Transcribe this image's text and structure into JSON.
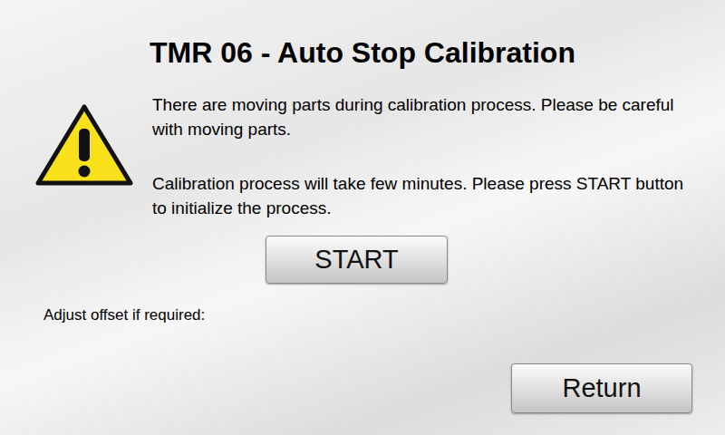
{
  "window": {
    "title": "TMR 06 - Auto Stop Calibration"
  },
  "warning": {
    "paragraphs": [
      "There are moving parts during calibration process. Please be careful with moving parts.",
      "Calibration process will take few minutes. Please press START button to initialize the process."
    ]
  },
  "start_button": {
    "label": "START"
  },
  "offset": {
    "label": "Adjust offset if required:"
  },
  "return_button": {
    "label": "Return"
  }
}
